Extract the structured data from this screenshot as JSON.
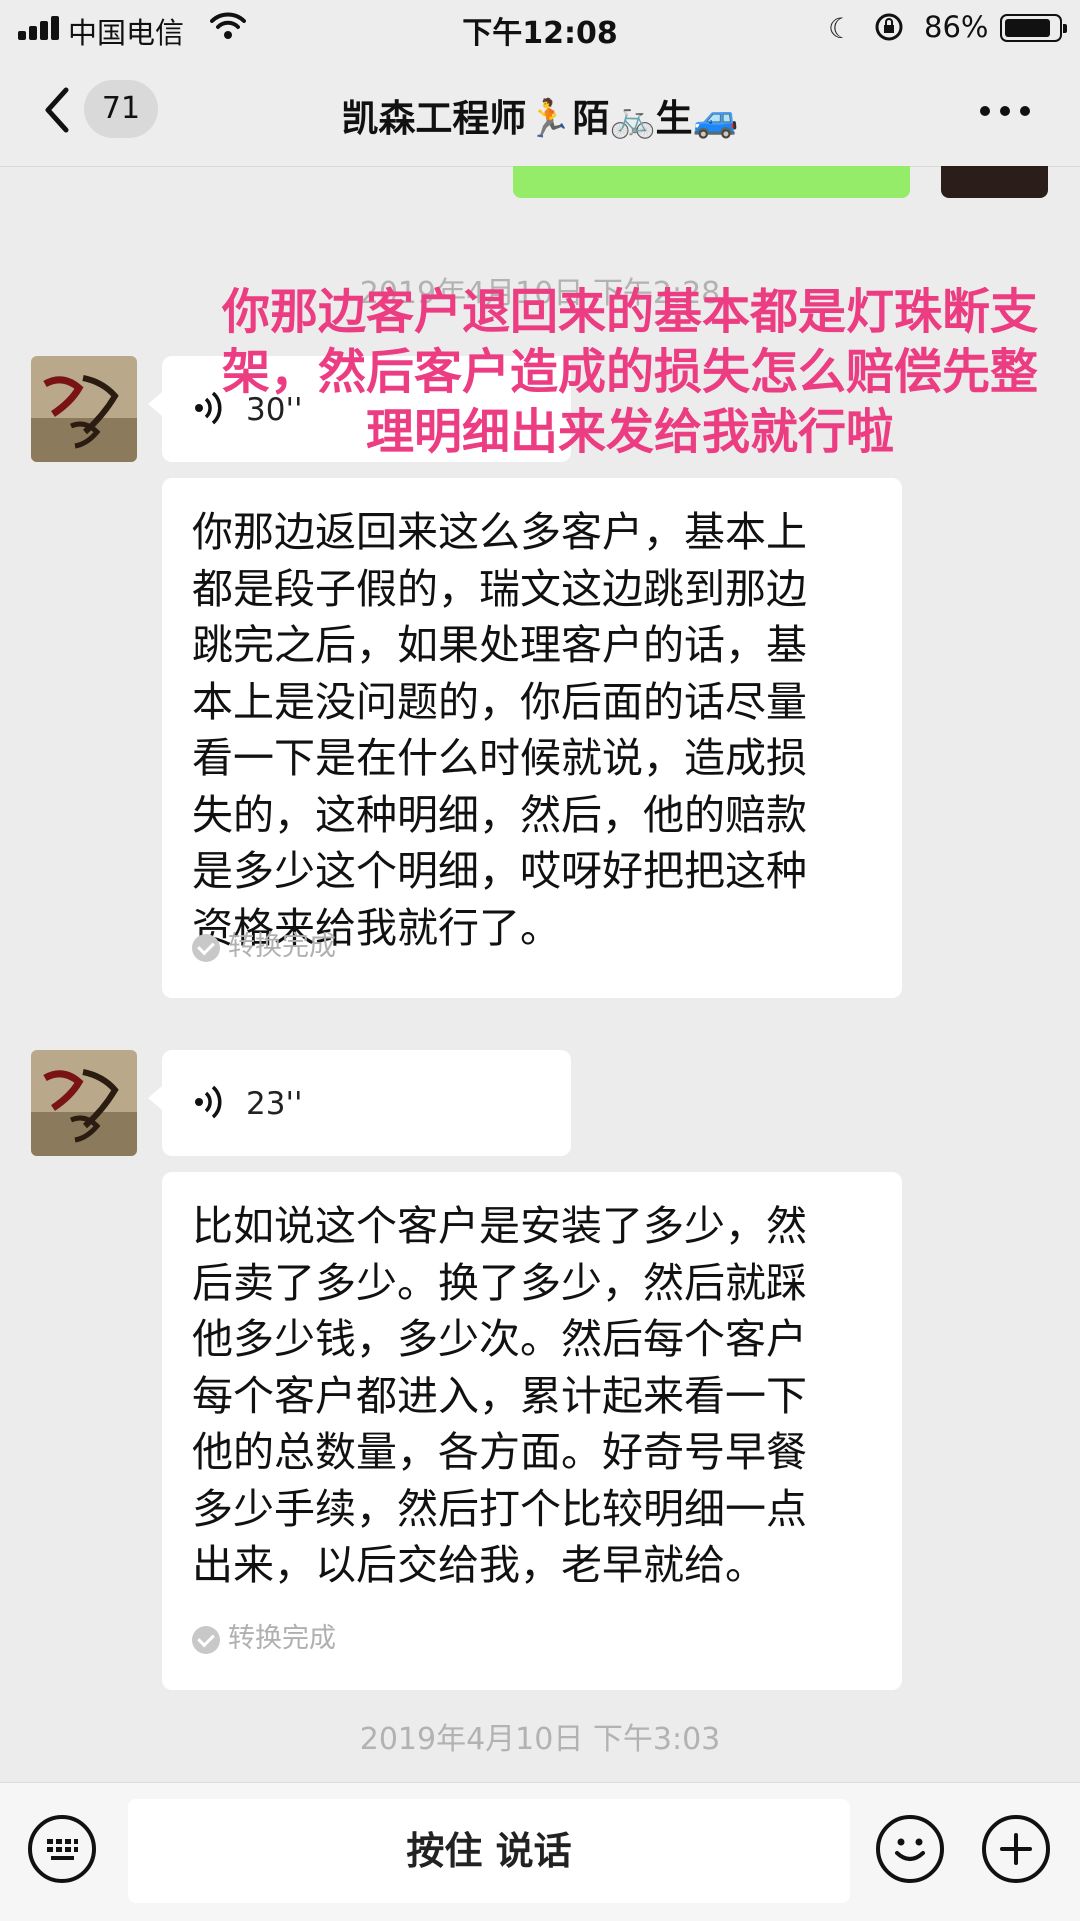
{
  "status_bar": {
    "carrier": "中国电信",
    "time": "下午12:08",
    "battery_percent": "86%",
    "battery_level": 0.86
  },
  "nav": {
    "unread_count": "71",
    "title": "凯森工程师🏃陌🚲生🚙"
  },
  "chat": {
    "overlay_annotation": "你那边客户退回来的基本都是灯珠断支架，然后客户造成的损失怎么赔偿先整理明细出来发给我就行啦",
    "timestamp_top": "2019年4月10日 下午2:28",
    "messages": [
      {
        "type": "voice",
        "duration": "30''",
        "transcript": "你那边返回来这么多客户，基本上都是段子假的，瑞文这边跳到那边跳完之后，如果处理客户的话，基本上是没问题的，你后面的话尽量看一下是在什么时候就说，造成损失的，这种明细，然后，他的赔款是多少这个明细，哎呀好把把这种资格来给我就行了。",
        "status": "转换完成"
      },
      {
        "type": "voice",
        "duration": "23''",
        "transcript": "比如说这个客户是安装了多少，然后卖了多少。换了多少，然后就踩他多少钱，多少次。然后每个客户每个客户都进入，累计起来看一下他的总数量，各方面。好奇号早餐多少手续，然后打个比较明细一点出来，以后交给我，老早就给。",
        "status": "转换完成"
      }
    ],
    "timestamp_bottom": "2019年4月10日 下午3:03"
  },
  "input_bar": {
    "hold_to_talk": "按住 说话"
  },
  "icons": [
    "keyboard-icon",
    "emoji-icon",
    "plus-icon",
    "voice-wave-icon",
    "back-chevron-icon",
    "more-icon",
    "wifi-icon",
    "signal-icon",
    "moon-icon",
    "orientation-lock-icon",
    "battery-icon",
    "check-icon"
  ],
  "colors": {
    "background": "#ececec",
    "overlay_text": "#ec3c82",
    "sent_bubble": "#95ec69",
    "timestamp": "#b2b2b2"
  }
}
